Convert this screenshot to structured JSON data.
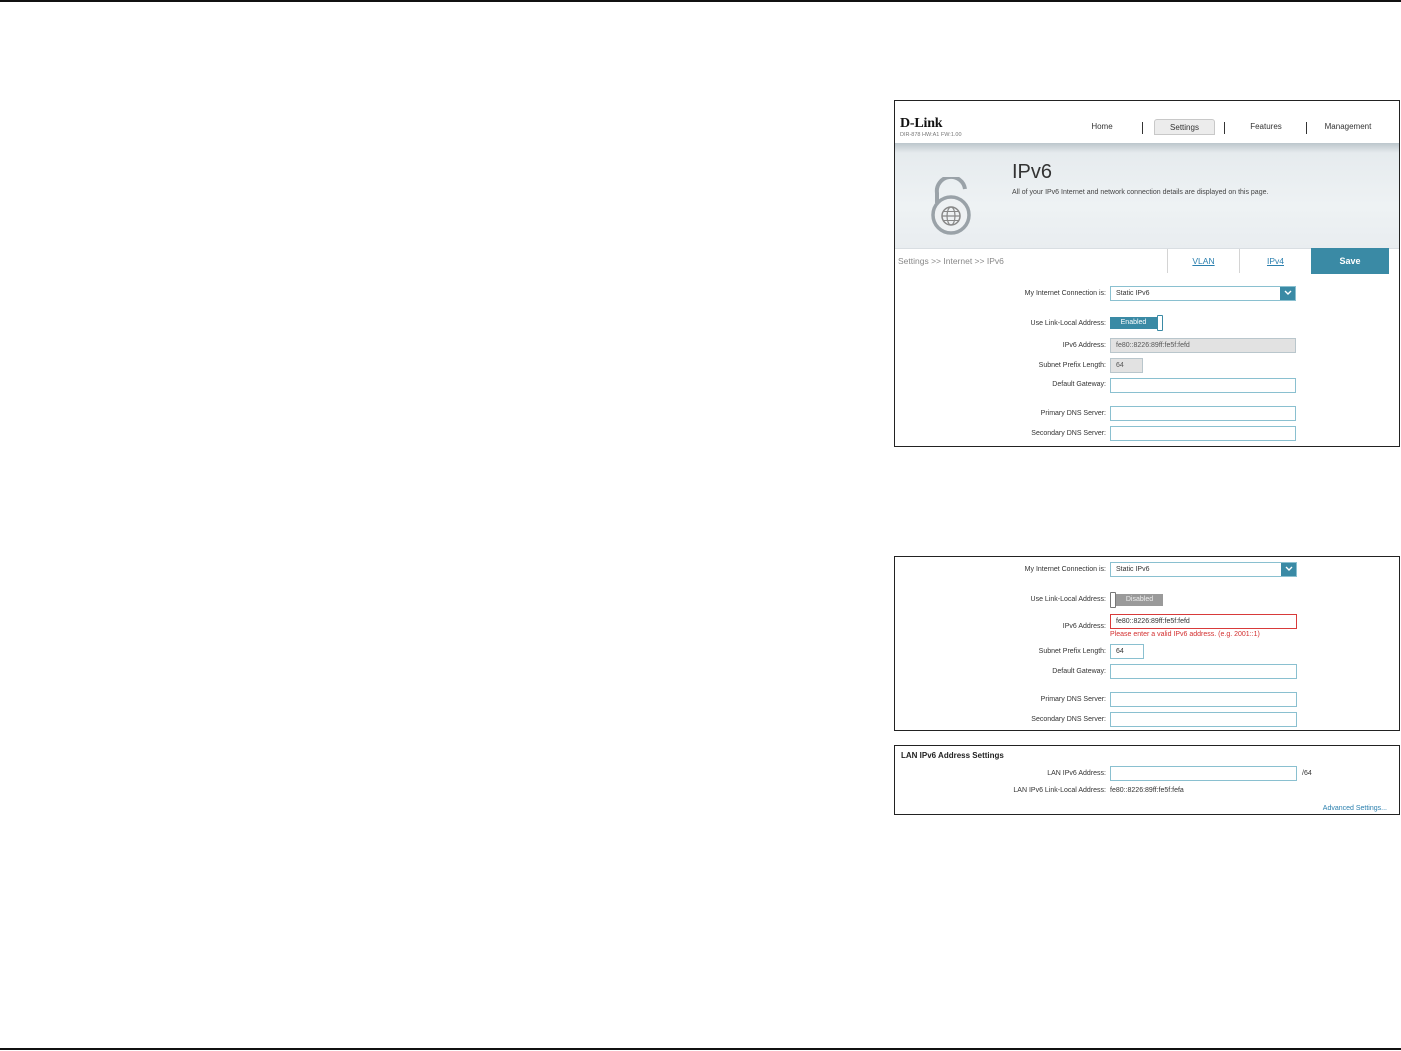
{
  "header": {
    "logo": "D-Link",
    "model": "DIR-878 HW:A1 FW:1.00",
    "nav": [
      "Home",
      "Settings",
      "Features",
      "Management"
    ]
  },
  "banner": {
    "title": "IPv6",
    "description": "All of your IPv6 Internet and network connection details are displayed on this page."
  },
  "toolbar": {
    "breadcrumb": "Settings >> Internet >> IPv6",
    "vlan_link": "VLAN",
    "ipv4_link": "IPv4",
    "save_label": "Save"
  },
  "form1": {
    "connection_label": "My Internet Connection is:",
    "connection_value": "Static IPv6",
    "link_local_label": "Use Link-Local Address:",
    "link_local_state": "Enabled",
    "ipv6_label": "IPv6 Address:",
    "ipv6_value": "fe80::8226:89ff:fe5f:fefd",
    "prefix_label": "Subnet Prefix Length:",
    "prefix_value": "64",
    "gateway_label": "Default Gateway:",
    "gateway_value": "",
    "dns1_label": "Primary DNS Server:",
    "dns1_value": "",
    "dns2_label": "Secondary DNS Server:",
    "dns2_value": ""
  },
  "form2": {
    "connection_label": "My Internet Connection is:",
    "connection_value": "Static IPv6",
    "link_local_label": "Use Link-Local Address:",
    "link_local_state": "Disabled",
    "ipv6_label": "IPv6 Address:",
    "ipv6_value": "fe80::8226:89ff:fe5f:fefd",
    "ipv6_error": "Please enter a valid IPv6 address. (e.g. 2001::1)",
    "prefix_label": "Subnet Prefix Length:",
    "prefix_value": "64",
    "gateway_label": "Default Gateway:",
    "gateway_value": "",
    "dns1_label": "Primary DNS Server:",
    "dns1_value": "",
    "dns2_label": "Secondary DNS Server:",
    "dns2_value": ""
  },
  "lan": {
    "title": "LAN IPv6 Address Settings",
    "address_label": "LAN IPv6 Address:",
    "address_value": "",
    "address_suffix": "/64",
    "link_local_label": "LAN IPv6 Link-Local Address:",
    "link_local_value": "fe80::8226:89ff:fe5f:fefa",
    "advanced_link": "Advanced Settings..."
  },
  "colors": {
    "accent": "#3a8aa5",
    "error": "#d32f2f",
    "link": "#2a7fae"
  }
}
